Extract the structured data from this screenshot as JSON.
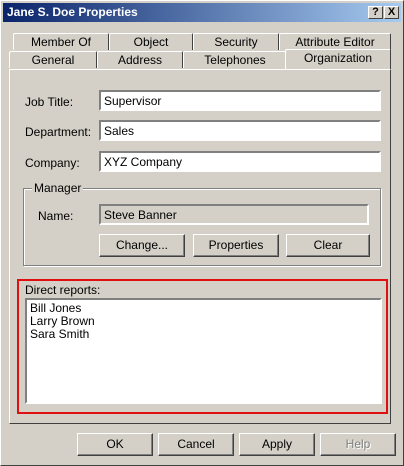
{
  "window": {
    "title": "Jane S. Doe Properties",
    "help_btn": "?",
    "close_btn": "X"
  },
  "tabs": {
    "row1": [
      "Member Of",
      "Object",
      "Security",
      "Attribute Editor"
    ],
    "row2": [
      "General",
      "Address",
      "Telephones",
      "Organization"
    ],
    "active": "Organization"
  },
  "form": {
    "job_title_label": "Job Title:",
    "job_title": "Supervisor",
    "department_label": "Department:",
    "department": "Sales",
    "company_label": "Company:",
    "company": "XYZ Company"
  },
  "manager": {
    "legend": "Manager",
    "name_label": "Name:",
    "name": "Steve Banner",
    "change_button": "Change...",
    "properties_button": "Properties",
    "clear_button": "Clear"
  },
  "direct_reports": {
    "label": "Direct reports:",
    "items": [
      "Bill Jones",
      "Larry Brown",
      "Sara Smith"
    ]
  },
  "footer": {
    "ok": "OK",
    "cancel": "Cancel",
    "apply": "Apply",
    "help": "Help"
  },
  "colors": {
    "titlebar": "#0a246a",
    "dialog_bg": "#d4d0c8",
    "highlight": "#e01010"
  }
}
